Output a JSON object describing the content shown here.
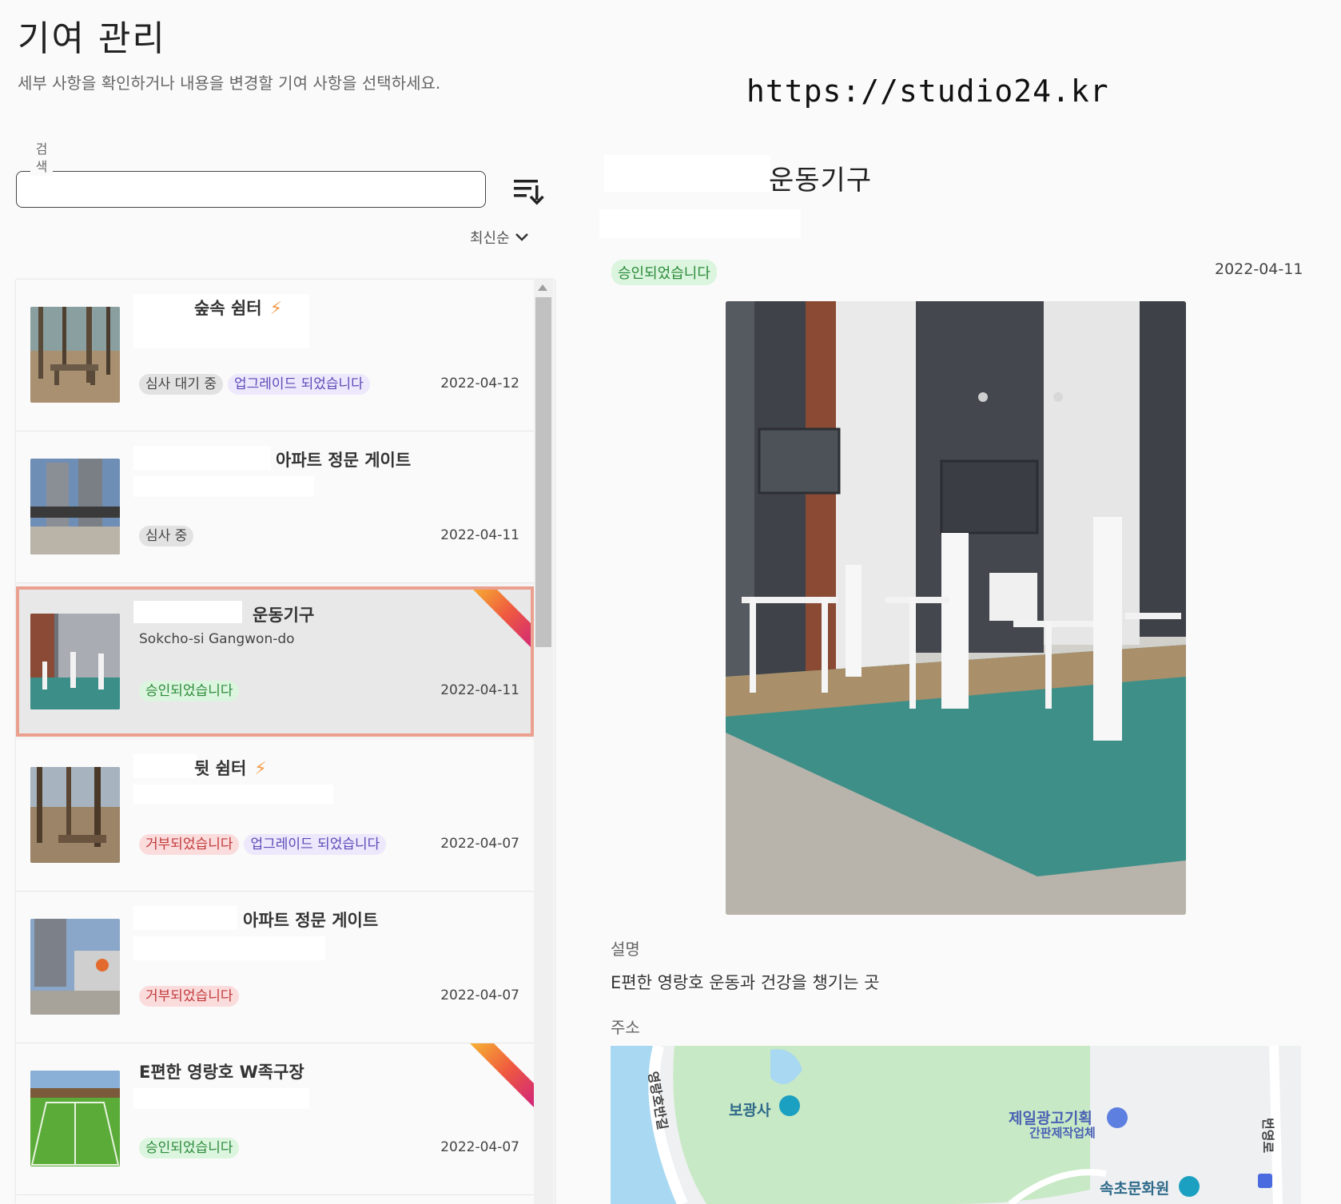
{
  "header": {
    "title": "기여 관리",
    "subtitle": "세부 사항을 확인하거나 내용을 변경할 기여 사항을 선택하세요.",
    "watermark": "https://studio24.kr"
  },
  "search": {
    "label": "검색",
    "value": "",
    "placeholder": ""
  },
  "sort": {
    "selected": "최신순",
    "icon": "sort-icon"
  },
  "colors": {
    "selected_border": "#eba08f",
    "approved": "#2c8b3a",
    "rejected": "#c0393b",
    "upgraded": "#5b4bb8"
  },
  "list": {
    "items": [
      {
        "title": "숲속 쉼터",
        "subtitle": "",
        "chips": [
          {
            "label": "심사 대기 중",
            "kind": "gray"
          },
          {
            "label": "업그레이드 되었습니다",
            "kind": "purple"
          }
        ],
        "date": "2022-04-12",
        "bolt": true,
        "ribbon": false
      },
      {
        "title": "아파트 정문 게이트",
        "subtitle": "",
        "chips": [
          {
            "label": "심사 중",
            "kind": "gray"
          }
        ],
        "date": "2022-04-11",
        "bolt": false,
        "ribbon": false
      },
      {
        "title": "운동기구",
        "subtitle": "Sokcho-si Gangwon-do",
        "chips": [
          {
            "label": "승인되었습니다",
            "kind": "green"
          }
        ],
        "date": "2022-04-11",
        "bolt": false,
        "ribbon": true,
        "selected": true
      },
      {
        "title": "뒷 쉼터",
        "subtitle": "",
        "chips": [
          {
            "label": "거부되었습니다",
            "kind": "red"
          },
          {
            "label": "업그레이드 되었습니다",
            "kind": "purple"
          }
        ],
        "date": "2022-04-07",
        "bolt": true,
        "ribbon": false
      },
      {
        "title": "아파트 정문 게이트",
        "subtitle": "",
        "chips": [
          {
            "label": "거부되었습니다",
            "kind": "red"
          }
        ],
        "date": "2022-04-07",
        "bolt": false,
        "ribbon": false
      },
      {
        "title": "E편한 영랑호 W족구장",
        "subtitle": "",
        "chips": [
          {
            "label": "승인되었습니다",
            "kind": "green"
          }
        ],
        "date": "2022-04-07",
        "bolt": false,
        "ribbon": true
      }
    ]
  },
  "detail": {
    "title": "운동기구",
    "status": "승인되었습니다",
    "date": "2022-04-11",
    "description_label": "설명",
    "description": "E편한 영랑호 운동과 건강을 챙기는 곳",
    "address_label": "주소",
    "map_labels": {
      "temple": "보광사",
      "road_left": "영랑호반길",
      "ad_company": "제일광고기획",
      "ad_company_sub": "간판제작업체",
      "culture_center": "속초문화원",
      "road_right": "번영로"
    }
  }
}
